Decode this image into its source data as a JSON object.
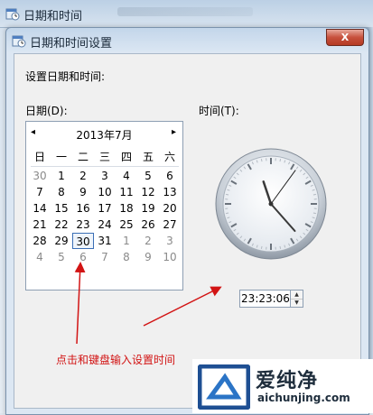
{
  "parent_window": {
    "title": "日期和时间"
  },
  "dialog": {
    "title": "日期和时间设置",
    "close_label": "X",
    "section_label": "设置日期和时间:",
    "date_label": "日期(D):",
    "time_label": "时间(T):"
  },
  "calendar": {
    "prev_symbol": "◂",
    "next_symbol": "▸",
    "month_title": "2013年7月",
    "weekdays": [
      "日",
      "一",
      "二",
      "三",
      "四",
      "五",
      "六"
    ],
    "weeks": [
      [
        "30",
        "1",
        "2",
        "3",
        "4",
        "5",
        "6"
      ],
      [
        "7",
        "8",
        "9",
        "10",
        "11",
        "12",
        "13"
      ],
      [
        "14",
        "15",
        "16",
        "17",
        "18",
        "19",
        "20"
      ],
      [
        "21",
        "22",
        "23",
        "24",
        "25",
        "26",
        "27"
      ],
      [
        "28",
        "29",
        "30",
        "31",
        "1",
        "2",
        "3"
      ],
      [
        "4",
        "5",
        "6",
        "7",
        "8",
        "9",
        "10"
      ]
    ],
    "selected_day": "30"
  },
  "clock": {
    "hours": 23,
    "minutes": 23,
    "seconds": 6
  },
  "time_field": {
    "value": "23:23:06",
    "up_symbol": "▲",
    "down_symbol": "▼"
  },
  "annotation": {
    "text": "点击和键盘输入设置时间",
    "color": "#d21414"
  },
  "watermark": {
    "brand": "爱纯净",
    "url": "aichunjing.com"
  }
}
